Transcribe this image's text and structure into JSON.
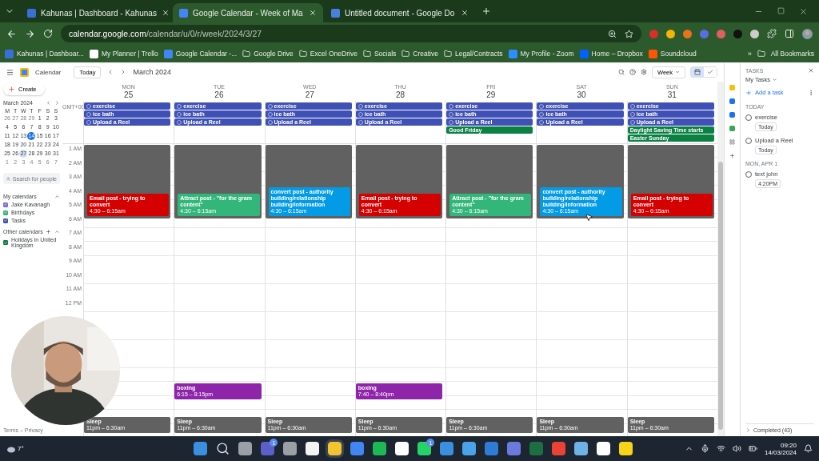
{
  "browser": {
    "tabs": [
      {
        "title": "Kahunas | Dashboard - Kahunas",
        "selected": false,
        "color": "#3b6fd8"
      },
      {
        "title": "Google Calendar - Week of Ma",
        "selected": true,
        "color": "#4285f4"
      },
      {
        "title": "Untitled document - Google Do",
        "selected": false,
        "color": "#4a7fe0"
      }
    ],
    "url_host": "calendar.google.com",
    "url_path": "/calendar/u/0/r/week/2024/3/27",
    "extensions": [
      {
        "color": "#d93025"
      },
      {
        "color": "#f4b400"
      },
      {
        "color": "#e8711c"
      },
      {
        "color": "#5b6ee1"
      },
      {
        "color": "#e06060"
      },
      {
        "color": "#111111"
      },
      {
        "color": "#cccccc"
      }
    ],
    "bookmarks": [
      {
        "label": "Kahunas | Dashboar...",
        "color": "#3b6fd8"
      },
      {
        "label": "My Planner | Trello",
        "color": "#ffffff"
      },
      {
        "label": "Google Calendar -...",
        "color": "#4285f4"
      },
      {
        "label": "Google Drive",
        "kind": "folder"
      },
      {
        "label": "Excel OneDrive",
        "kind": "folder"
      },
      {
        "label": "Socials",
        "kind": "folder"
      },
      {
        "label": "Creative",
        "kind": "folder"
      },
      {
        "label": "Legal/Contracts",
        "kind": "folder"
      },
      {
        "label": "My Profile - Zoom",
        "color": "#2d8cff"
      },
      {
        "label": "Home – Dropbox",
        "color": "#0061fe"
      },
      {
        "label": "Soundcloud",
        "color": "#ff5500"
      }
    ],
    "more": "»",
    "all_bookmarks": "All Bookmarks"
  },
  "calendar": {
    "app_name": "Calendar",
    "today_button": "Today",
    "month_title": "March 2024",
    "view_select": "Week",
    "view_modes": [
      {
        "kind": "calendar",
        "selected": true
      },
      {
        "kind": "tasks",
        "selected": false
      }
    ],
    "create_button": "Create",
    "mini_calendar": {
      "title": "March 2024",
      "weekdays": [
        "M",
        "T",
        "W",
        "T",
        "F",
        "S",
        "S"
      ],
      "weeks": [
        [
          {
            "label": "26",
            "kind": "outside"
          },
          {
            "label": "27",
            "kind": "outside"
          },
          {
            "label": "28",
            "kind": "outside"
          },
          {
            "label": "29",
            "kind": "outside"
          },
          {
            "label": "1",
            "kind": "day"
          },
          {
            "label": "2",
            "kind": "day"
          },
          {
            "label": "3",
            "kind": "day"
          }
        ],
        [
          {
            "label": "4",
            "kind": "day"
          },
          {
            "label": "5",
            "kind": "day"
          },
          {
            "label": "6",
            "kind": "day"
          },
          {
            "label": "7",
            "kind": "day"
          },
          {
            "label": "8",
            "kind": "day"
          },
          {
            "label": "9",
            "kind": "day"
          },
          {
            "label": "10",
            "kind": "day"
          }
        ],
        [
          {
            "label": "11",
            "kind": "day"
          },
          {
            "label": "12",
            "kind": "day"
          },
          {
            "label": "13",
            "kind": "day"
          },
          {
            "label": "14",
            "kind": "today"
          },
          {
            "label": "15",
            "kind": "day"
          },
          {
            "label": "16",
            "kind": "day"
          },
          {
            "label": "17",
            "kind": "day"
          }
        ],
        [
          {
            "label": "18",
            "kind": "day"
          },
          {
            "label": "19",
            "kind": "day"
          },
          {
            "label": "20",
            "kind": "day"
          },
          {
            "label": "21",
            "kind": "day"
          },
          {
            "label": "22",
            "kind": "day"
          },
          {
            "label": "23",
            "kind": "day"
          },
          {
            "label": "24",
            "kind": "day"
          }
        ],
        [
          {
            "label": "25",
            "kind": "day"
          },
          {
            "label": "26",
            "kind": "day"
          },
          {
            "label": "27",
            "kind": "viewed"
          },
          {
            "label": "28",
            "kind": "day"
          },
          {
            "label": "29",
            "kind": "day"
          },
          {
            "label": "30",
            "kind": "day"
          },
          {
            "label": "31",
            "kind": "day"
          }
        ],
        [
          {
            "label": "1",
            "kind": "outside"
          },
          {
            "label": "2",
            "kind": "outside"
          },
          {
            "label": "3",
            "kind": "outside"
          },
          {
            "label": "4",
            "kind": "outside"
          },
          {
            "label": "5",
            "kind": "outside"
          },
          {
            "label": "6",
            "kind": "outside"
          },
          {
            "label": "7",
            "kind": "outside"
          }
        ]
      ]
    },
    "search_people": {
      "placeholder": "Search for people"
    },
    "my_calendars": {
      "title": "My calendars",
      "items": [
        {
          "label": "Jake Kavanagh",
          "checked": true,
          "color": "#7c6cd8"
        },
        {
          "label": "Birthdays",
          "checked": true,
          "color": "#33b679"
        },
        {
          "label": "Tasks",
          "checked": true,
          "color": "#3f51b5"
        }
      ]
    },
    "other_calendars": {
      "title": "Other calendars",
      "items": [
        {
          "label": "Holidays in United Kingdom",
          "checked": true,
          "color": "#0b8043"
        }
      ]
    },
    "footer": "Terms – Privacy",
    "timezone": "GMT+00",
    "hours": [
      "1 AM",
      "2 AM",
      "3 AM",
      "4 AM",
      "5 AM",
      "6 AM",
      "7 AM",
      "8 AM",
      "9 AM",
      "10 AM",
      "11 AM",
      "12 PM"
    ],
    "days": [
      {
        "weekday": "MON",
        "date": "25",
        "allday": [
          {
            "title": "exercise",
            "kind": "task",
            "color": "#3f51b5"
          },
          {
            "title": "ice bath",
            "kind": "task",
            "color": "#3f51b5"
          },
          {
            "title": "Upload a Reel",
            "kind": "task",
            "color": "#3f51b5"
          }
        ],
        "block": {
          "title": "Email post - trying to convert",
          "time": "4:30 – 6:15am",
          "color": "#d50000"
        },
        "sleep": {
          "title": "Sleep",
          "time": "11pm – 6:30am"
        }
      },
      {
        "weekday": "TUE",
        "date": "26",
        "allday": [
          {
            "title": "exercise",
            "kind": "task",
            "color": "#3f51b5"
          },
          {
            "title": "ice bath",
            "kind": "task",
            "color": "#3f51b5"
          },
          {
            "title": "Upload a Reel",
            "kind": "task",
            "color": "#3f51b5"
          }
        ],
        "block": {
          "title": "Attract post - \"for the gram content\"",
          "time": "4:30 – 6:15am",
          "color": "#33b679"
        },
        "evening": {
          "title": "boxing",
          "time": "6:15 – 8:15pm",
          "color": "#8e24aa"
        },
        "sleep": {
          "title": "Sleep",
          "time": "11pm – 6:30am"
        }
      },
      {
        "weekday": "WED",
        "date": "27",
        "allday": [
          {
            "title": "exercise",
            "kind": "task",
            "color": "#3f51b5"
          },
          {
            "title": "ice bath",
            "kind": "task",
            "color": "#3f51b5"
          },
          {
            "title": "Upload a Reel",
            "kind": "task",
            "color": "#3f51b5"
          }
        ],
        "block": {
          "title": "convert post - authority building/relationship building/information",
          "time": "4:30 – 6:15am",
          "color": "#039be5"
        },
        "sleep": {
          "title": "Sleep",
          "time": "11pm – 6:30am"
        }
      },
      {
        "weekday": "THU",
        "date": "28",
        "allday": [
          {
            "title": "exercise",
            "kind": "task",
            "color": "#3f51b5"
          },
          {
            "title": "ice bath",
            "kind": "task",
            "color": "#3f51b5"
          },
          {
            "title": "Upload a Reel",
            "kind": "task",
            "color": "#3f51b5"
          }
        ],
        "block": {
          "title": "Email post - trying to convert",
          "time": "4:30 – 6:15am",
          "color": "#d50000"
        },
        "evening": {
          "title": "boxing",
          "time": "7:40 – 8:40pm",
          "color": "#8e24aa"
        },
        "sleep": {
          "title": "Sleep",
          "time": "11pm – 6:30am"
        }
      },
      {
        "weekday": "FRI",
        "date": "29",
        "allday": [
          {
            "title": "exercise",
            "kind": "task",
            "color": "#3f51b5"
          },
          {
            "title": "ice bath",
            "kind": "task",
            "color": "#3f51b5"
          },
          {
            "title": "Upload a Reel",
            "kind": "task",
            "color": "#3f51b5"
          },
          {
            "title": "Good Friday",
            "kind": "event",
            "color": "#0b8043"
          }
        ],
        "block": {
          "title": "Attract post - \"for the gram content\"",
          "time": "4:30 – 6:15am",
          "color": "#33b679"
        },
        "sleep": {
          "title": "Sleep",
          "time": "11pm – 6:30am"
        }
      },
      {
        "weekday": "SAT",
        "date": "30",
        "allday": [
          {
            "title": "exercise",
            "kind": "task",
            "color": "#3f51b5"
          },
          {
            "title": "ice bath",
            "kind": "task",
            "color": "#3f51b5"
          },
          {
            "title": "Upload a Reel",
            "kind": "task",
            "color": "#3f51b5"
          }
        ],
        "block": {
          "title": "convert post - authority building/relationship building/information",
          "time": "4:30 – 6:15am",
          "color": "#039be5"
        },
        "sleep": {
          "title": "Sleep",
          "time": "11pm – 6:30am"
        }
      },
      {
        "weekday": "SUN",
        "date": "31",
        "allday": [
          {
            "title": "exercise",
            "kind": "task",
            "color": "#3f51b5"
          },
          {
            "title": "ice bath",
            "kind": "task",
            "color": "#3f51b5"
          },
          {
            "title": "Upload a Reel",
            "kind": "task",
            "color": "#3f51b5"
          },
          {
            "title": "Daylight Saving Time starts",
            "kind": "event",
            "color": "#0b8043"
          },
          {
            "title": "Easter Sunday",
            "kind": "event",
            "color": "#0b8043"
          }
        ],
        "block": {
          "title": "Email post - trying to convert",
          "time": "4:30 – 6:15am",
          "color": "#d50000"
        },
        "sleep": {
          "title": "Sleep",
          "time": "11pm – 6:30am"
        }
      }
    ]
  },
  "tasks_panel": {
    "label": "TASKS",
    "list": "My Tasks",
    "add": "Add a task",
    "groups": [
      {
        "heading": "TODAY",
        "items": [
          {
            "title": "exercise",
            "chip": "Today",
            "checked": false
          },
          {
            "title": "Upload a Reel",
            "chip": "Today",
            "checked": false
          }
        ]
      },
      {
        "heading": "MON, APR 1",
        "items": [
          {
            "title": "text john",
            "chip": "4:20PM",
            "checked": false
          }
        ]
      }
    ],
    "completed": "Completed (43)"
  },
  "side_apps": [
    {
      "color": "#fbbc04"
    },
    {
      "color": "#1a73e8"
    },
    {
      "color": "#1a73e8"
    },
    {
      "color": "#34a853"
    }
  ],
  "taskbar": {
    "weather": "7°",
    "apps": [
      {
        "color": "#3b8fe0"
      },
      {
        "color": "#e0e0e0",
        "kind": "search"
      },
      {
        "color": "#9aa0a6"
      },
      {
        "color": "#5b5fc7",
        "badge": "1"
      },
      {
        "color": "#9aa0a6"
      },
      {
        "color": "#f3f3f3"
      },
      {
        "color": "#f4c430",
        "selected": true
      },
      {
        "color": "#4285f4"
      },
      {
        "color": "#1db954"
      },
      {
        "color": "#ffffff"
      },
      {
        "color": "#25d366",
        "badge": "1"
      },
      {
        "color": "#3b8fe0"
      },
      {
        "color": "#4aa3e8"
      },
      {
        "color": "#2f7bd6"
      },
      {
        "color": "#6c7ae0"
      },
      {
        "color": "#1d6f42"
      },
      {
        "color": "#ea4335"
      },
      {
        "color": "#6fb2e8"
      },
      {
        "color": "#ffffff"
      },
      {
        "color": "#f7d417"
      }
    ],
    "time": "09:20",
    "date": "14/03/2024"
  }
}
